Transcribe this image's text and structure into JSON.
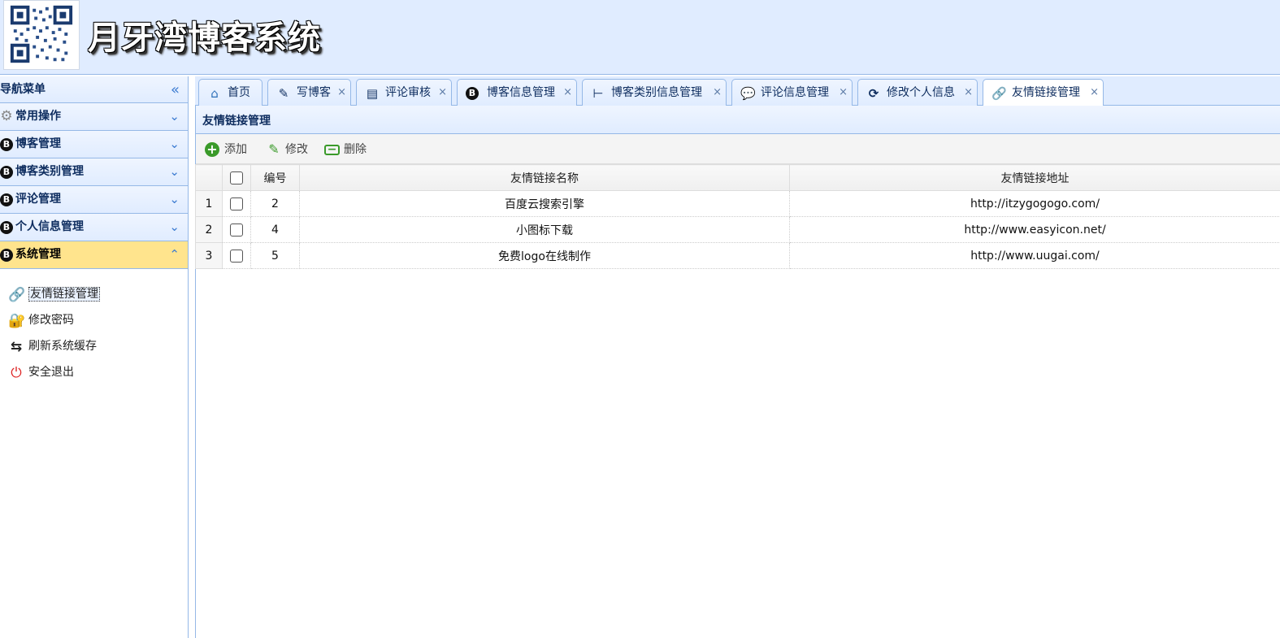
{
  "header": {
    "title": "月牙湾博客系统",
    "logo": "qr-code-image"
  },
  "sidebar": {
    "title": "导航菜单",
    "collapse_icon": "double-chevron-left",
    "sections": [
      {
        "label": "常用操作",
        "icon": "gear-icon"
      },
      {
        "label": "博客管理",
        "icon": "blogger-icon"
      },
      {
        "label": "博客类别管理",
        "icon": "blogger-icon"
      },
      {
        "label": "评论管理",
        "icon": "blogger-icon"
      },
      {
        "label": "个人信息管理",
        "icon": "blogger-icon"
      },
      {
        "label": "系统管理",
        "icon": "blogger-icon",
        "expanded": true
      }
    ],
    "submenu": [
      {
        "label": "友情链接管理",
        "icon": "link-icon",
        "selected": true
      },
      {
        "label": "修改密码",
        "icon": "lock-icon"
      },
      {
        "label": "刷新系统缓存",
        "icon": "refresh-icon"
      },
      {
        "label": "安全退出",
        "icon": "exit-icon"
      }
    ]
  },
  "tabs": [
    {
      "label": "首页",
      "icon": "home-icon",
      "closable": false
    },
    {
      "label": "写博客",
      "icon": "edit-icon",
      "closable": true
    },
    {
      "label": "评论审核",
      "icon": "review-icon",
      "closable": true
    },
    {
      "label": "博客信息管理",
      "icon": "blogger-icon",
      "closable": true
    },
    {
      "label": "博客类别信息管理",
      "icon": "tree-icon",
      "closable": true
    },
    {
      "label": "评论信息管理",
      "icon": "comment-icon",
      "closable": true
    },
    {
      "label": "修改个人信息",
      "icon": "refresh-icon",
      "closable": true
    },
    {
      "label": "友情链接管理",
      "icon": "link-icon",
      "closable": true,
      "active": true
    }
  ],
  "tab_close_glyph": "×",
  "panel": {
    "title": "友情链接管理",
    "toolbar": {
      "add": "添加",
      "edit": "修改",
      "delete": "删除"
    },
    "columns": [
      "编号",
      "友情链接名称",
      "友情链接地址"
    ],
    "rows": [
      {
        "rownum": "1",
        "id": "2",
        "name": "百度云搜索引擎",
        "url": "http://itzygogogo.com/"
      },
      {
        "rownum": "2",
        "id": "4",
        "name": "小图标下载",
        "url": "http://www.easyicon.net/"
      },
      {
        "rownum": "3",
        "id": "5",
        "name": "免费logo在线制作",
        "url": "http://www.uugai.com/"
      }
    ]
  },
  "colors": {
    "header_bg": "#e0ecff",
    "border": "#95b8e7",
    "active_section": "#ffe48d",
    "title_text": "#0e2d5f"
  }
}
